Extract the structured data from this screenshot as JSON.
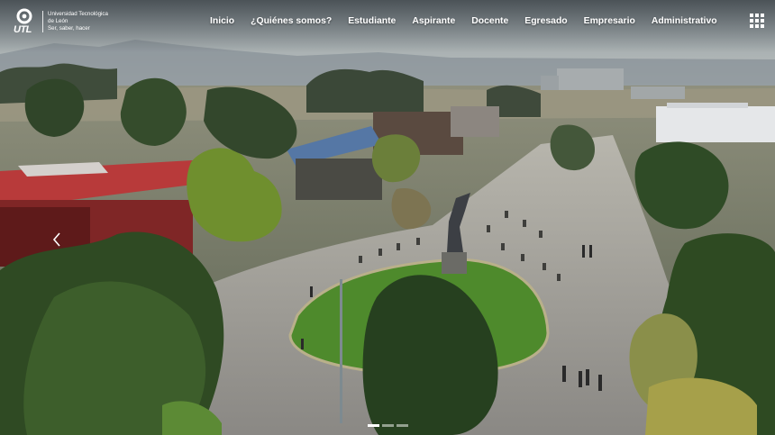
{
  "brand": {
    "logo_text": "UTL",
    "name_line1": "Universidad Tecnológica",
    "name_line2": "de León",
    "tagline": "Ser, saber, hacer"
  },
  "nav": {
    "items": [
      {
        "label": "Inicio"
      },
      {
        "label": "¿Quiénes somos?"
      },
      {
        "label": "Estudiante"
      },
      {
        "label": "Aspirante"
      },
      {
        "label": "Docente"
      },
      {
        "label": "Egresado"
      },
      {
        "label": "Empresario"
      },
      {
        "label": "Administrativo"
      }
    ]
  },
  "controls": {
    "menu_icon": "grid-menu-icon",
    "prev_icon": "chevron-left-icon"
  },
  "carousel": {
    "slide_count": 3,
    "active_index": 0
  },
  "colors": {
    "nav_text": "#ffffff",
    "roof_red": "#a52a2a",
    "lawn_green": "#4e8a2c"
  }
}
